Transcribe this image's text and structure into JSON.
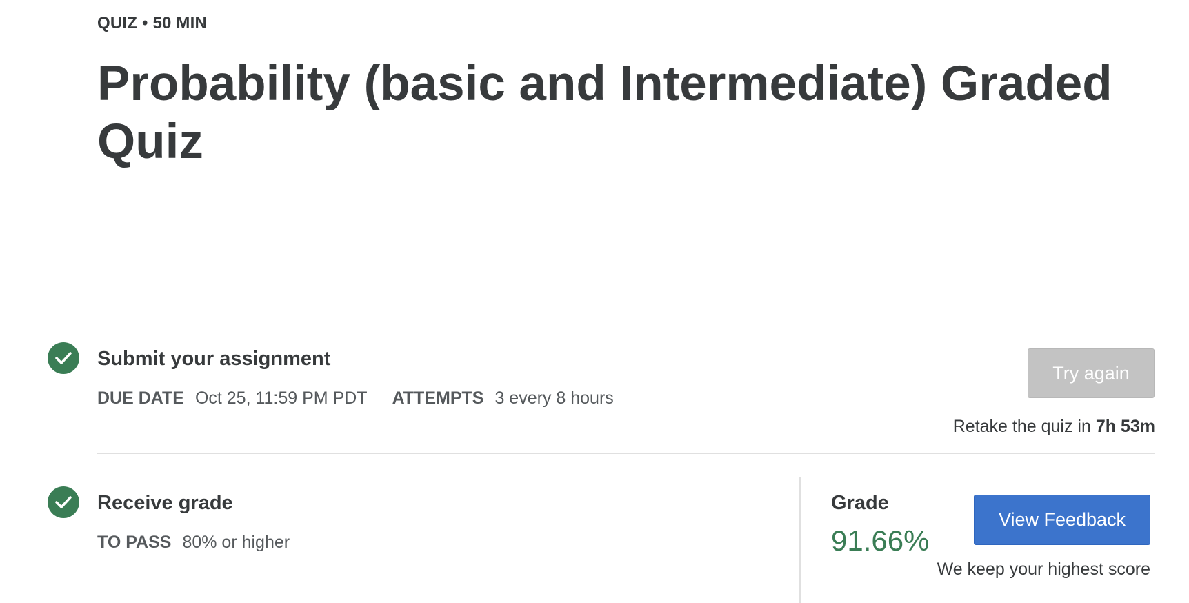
{
  "header": {
    "meta": "QUIZ • 50 MIN",
    "title": "Probability (basic and Intermediate) Graded Quiz"
  },
  "submit_step": {
    "icon": "checkmark-circle-icon",
    "status": "completed",
    "title": "Submit your assignment",
    "due_date_label": "DUE DATE",
    "due_date_value": "Oct 25, 11:59 PM PDT",
    "attempts_label": "ATTEMPTS",
    "attempts_value": "3 every 8 hours",
    "try_again_label": "Try again",
    "retake_prefix": "Retake the quiz in",
    "retake_time": "7h 53m"
  },
  "grade_step": {
    "icon": "checkmark-circle-icon",
    "status": "completed",
    "title": "Receive grade",
    "to_pass_label": "TO PASS",
    "to_pass_value": "80% or higher",
    "grade_label": "Grade",
    "grade_value": "91.66%",
    "view_feedback_label": "View Feedback",
    "keep_score_note": "We keep your highest score"
  },
  "colors": {
    "text": "#373a3c",
    "success_green": "#3a7d55",
    "primary_blue": "#3c74cc",
    "disabled_gray": "#c3c3c3"
  }
}
